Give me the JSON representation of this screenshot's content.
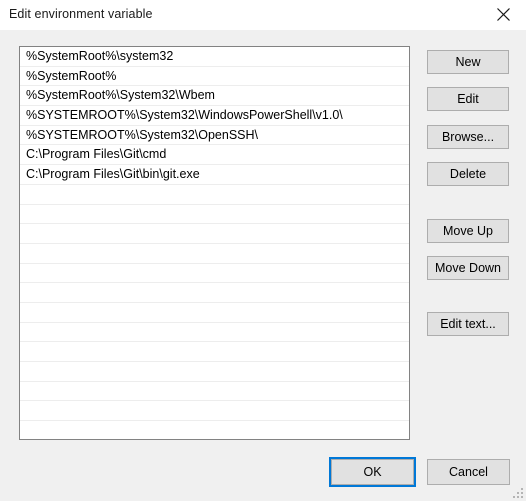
{
  "window": {
    "title": "Edit environment variable",
    "close_icon": "close-icon"
  },
  "list": {
    "entries": [
      "%SystemRoot%\\system32",
      "%SystemRoot%",
      "%SystemRoot%\\System32\\Wbem",
      "%SYSTEMROOT%\\System32\\WindowsPowerShell\\v1.0\\",
      "%SYSTEMROOT%\\System32\\OpenSSH\\",
      "C:\\Program Files\\Git\\cmd",
      "C:\\Program Files\\Git\\bin\\git.exe"
    ],
    "empty_row_count": 13
  },
  "side_buttons": {
    "new": "New",
    "edit": "Edit",
    "browse": "Browse...",
    "delete": "Delete",
    "move_up": "Move Up",
    "move_down": "Move Down",
    "edit_text": "Edit text..."
  },
  "footer": {
    "ok": "OK",
    "cancel": "Cancel"
  },
  "colors": {
    "accent": "#0078d7",
    "dialog_bg": "#f0f0f0",
    "button_face": "#e1e1e1",
    "button_border": "#adadad",
    "list_border": "#828282",
    "row_separator": "#ededed"
  }
}
